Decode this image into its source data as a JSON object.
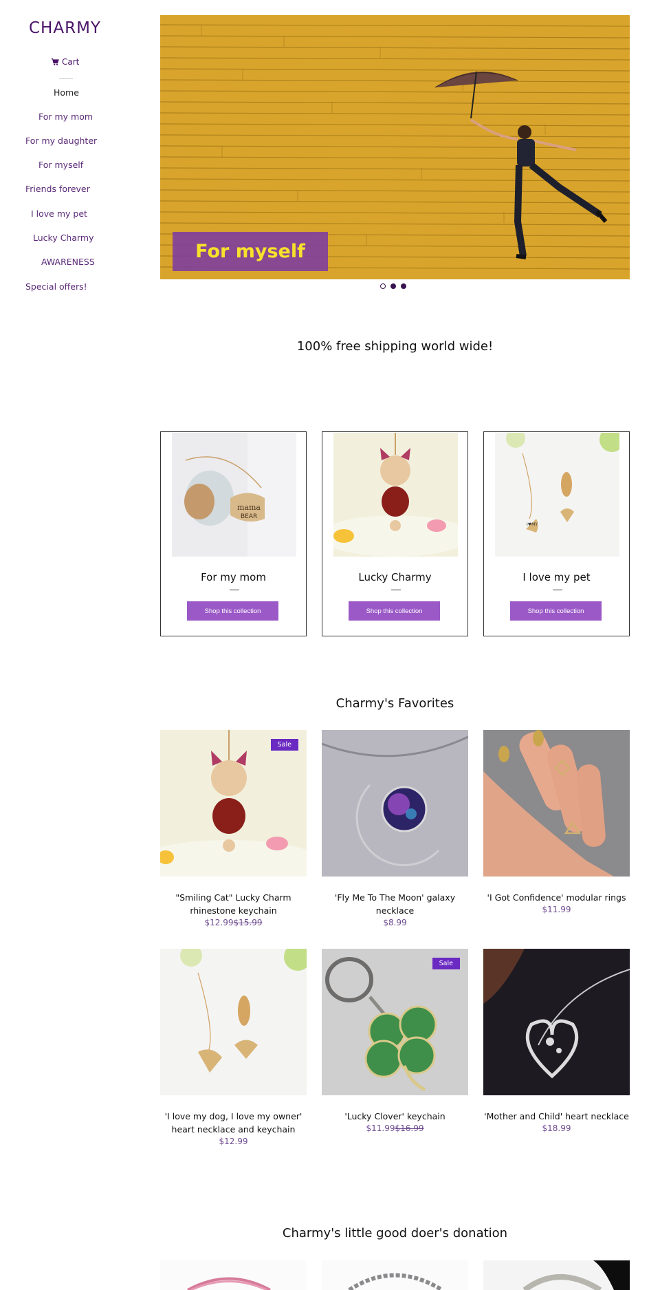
{
  "brand": {
    "logo": "CHARMY",
    "accent": "#9b59c7",
    "logo_color": "#4a1468"
  },
  "cart": {
    "label": "Cart",
    "icon": "cart-icon"
  },
  "nav": {
    "items": [
      {
        "label": "Home"
      },
      {
        "label": "For my mom"
      },
      {
        "label": "For my daughter"
      },
      {
        "label": "For myself"
      },
      {
        "label": "Friends forever"
      },
      {
        "label": "I love my pet"
      },
      {
        "label": "Lucky Charmy"
      },
      {
        "label": "AWARENESS"
      },
      {
        "label": "Special offers!"
      }
    ]
  },
  "hero": {
    "caption": "For myself",
    "slides": 3,
    "active_slide": 0
  },
  "shipping_banner": "100% free shipping world wide!",
  "collections": [
    {
      "title": "For my mom",
      "button": "Shop this collection"
    },
    {
      "title": "Lucky Charmy",
      "button": "Shop this collection"
    },
    {
      "title": "I love my pet",
      "button": "Shop this collection"
    }
  ],
  "favorites": {
    "title": "Charmy's Favorites",
    "products": [
      {
        "name": "\"Smiling Cat\" Lucky Charm rhinestone keychain",
        "price": "$12.99",
        "compare": "$15.99",
        "badge": "Sale"
      },
      {
        "name": "'Fly Me To The Moon' galaxy necklace",
        "price": "$8.99",
        "compare": "",
        "badge": ""
      },
      {
        "name": "'I Got Confidence' modular rings",
        "price": "$11.99",
        "compare": "",
        "badge": ""
      },
      {
        "name": "'I love my dog, I love my owner' heart necklace and keychain",
        "price": "$12.99",
        "compare": "",
        "badge": ""
      },
      {
        "name": "'Lucky Clover' keychain",
        "price": "$11.99",
        "compare": "$16.99",
        "badge": "Sale"
      },
      {
        "name": "'Mother and Child' heart necklace",
        "price": "$18.99",
        "compare": "",
        "badge": ""
      }
    ]
  },
  "donation": {
    "title": "Charmy's little good doer's donation"
  }
}
